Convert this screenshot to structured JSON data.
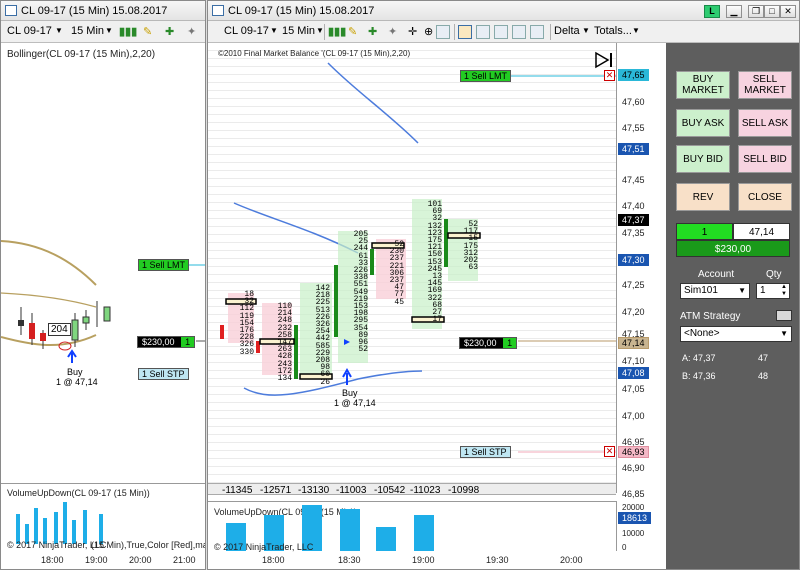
{
  "left_window": {
    "title": "CL 09-17 (15 Min)  15.08.2017",
    "instrument": "CL 09-17",
    "interval": "15 Min",
    "indicator_label": "Bollinger(CL 09-17 (15 Min),2,20)",
    "sell_lmt": "1  Sell LMT",
    "position": "$230,00",
    "position_qty": "1",
    "sell_stp": "1  Sell STP",
    "trade_label": "Buy",
    "trade_price": "1 @ 47,14",
    "candle_marker": "204",
    "volume_label": "VolumeUpDown(CL 09-17 (15 Min))",
    "copyright": "© 2017 NinjaTrader, LLC",
    "footer_text": "(15 Min),True,Color [Red],ma",
    "times": [
      "18:00",
      "19:00",
      "20:00",
      "21:00"
    ]
  },
  "right_window": {
    "title": "CL 09-17 (15 Min)  15.08.2017",
    "instrument": "CL 09-17",
    "interval": "15 Min",
    "delta_label": "Delta",
    "totals_label": "Totals...",
    "indicator_label": "©2010 Final Market Balance  '(CL 09-17 (15 Min),2,20)",
    "f_label": "F",
    "sell_lmt": "1  Sell LMT",
    "sell_lmt_price": "47,65",
    "position": "$230,00",
    "position_qty": "1",
    "position_price": "47,14",
    "sell_stp": "1  Sell STP",
    "sell_stp_price": "46,93",
    "price_ticks": [
      "47,60",
      "47,55",
      "47,51",
      "47,45",
      "47,40",
      "47,37",
      "47,35",
      "47,30",
      "47,25",
      "47,20",
      "47,15",
      "47,14",
      "47,10",
      "47,08",
      "47,05",
      "47,00",
      "46,95",
      "46,93",
      "46,90",
      "46,85"
    ],
    "trade_label": "Buy",
    "trade_price": "1 @ 47,14",
    "deltas": [
      "-11345",
      "-12571",
      "-13130",
      "-11003",
      "-10542",
      "-11023",
      "-10998"
    ],
    "volume_label": "VolumeUpDown(CL 09-17 (15 Min))",
    "volume_ticks": [
      "20000",
      "10000",
      "0"
    ],
    "volume_value": "18613",
    "copyright": "© 2017 NinjaTrader, LLC",
    "times": [
      "18:00",
      "18:30",
      "19:00",
      "19:30",
      "20:00"
    ]
  },
  "order_panel": {
    "buy_market": "BUY\nMARKET",
    "sell_market": "SELL\nMARKET",
    "buy_ask": "BUY ASK",
    "sell_ask": "SELL ASK",
    "buy_bid": "BUY BID",
    "sell_bid": "SELL BID",
    "rev": "REV",
    "close": "CLOSE",
    "pos_qty": "1",
    "pos_price": "47,14",
    "pnl": "$230,00",
    "account_label": "Account",
    "qty_label": "Qty",
    "account_value": "Sim101",
    "qty_value": "1",
    "atm_label": "ATM Strategy",
    "atm_value": "<None>",
    "ask_label": "A: 47,37",
    "ask_size": "47",
    "bid_label": "B: 47,36",
    "bid_size": "48"
  },
  "footprint": {
    "col1": [
      "18",
      "32",
      "112",
      "119",
      "154",
      "176",
      "228",
      "326",
      "330"
    ],
    "col2": [
      "110",
      "214",
      "248",
      "232",
      "258",
      "147",
      "263",
      "428",
      "243",
      "172",
      "134"
    ],
    "col3": [
      "142",
      "218",
      "225",
      "513",
      "226",
      "326",
      "254",
      "442",
      "585",
      "229",
      "208",
      "98",
      "60",
      "26"
    ],
    "col4": [
      "205",
      "25",
      "244",
      "61",
      "33",
      "226",
      "338",
      "551",
      "549",
      "219",
      "153",
      "198",
      "295",
      "354",
      "89",
      "96",
      "52"
    ],
    "col5": [
      "52",
      "230",
      "237",
      "221",
      "306",
      "237",
      "47",
      "77",
      "45"
    ],
    "col6": [
      "101",
      "69",
      "32",
      "132",
      "123",
      "175",
      "121",
      "150",
      "153",
      "245",
      "13",
      "145",
      "169",
      "322",
      "68",
      "27",
      "17"
    ],
    "col7": [
      "52",
      "117",
      "15",
      "175",
      "312",
      "202",
      "63"
    ]
  },
  "colors": {
    "lmt_green": "#22cc22",
    "stp_blue": "#bfe6f2",
    "position_black": "#000000",
    "buy_btn": "#ccf0cc",
    "sell_btn": "#f7d3e0",
    "rev_btn": "#f8e0c8",
    "volume_bar": "#1eaee8",
    "panel_bg": "#5e5e5e"
  }
}
